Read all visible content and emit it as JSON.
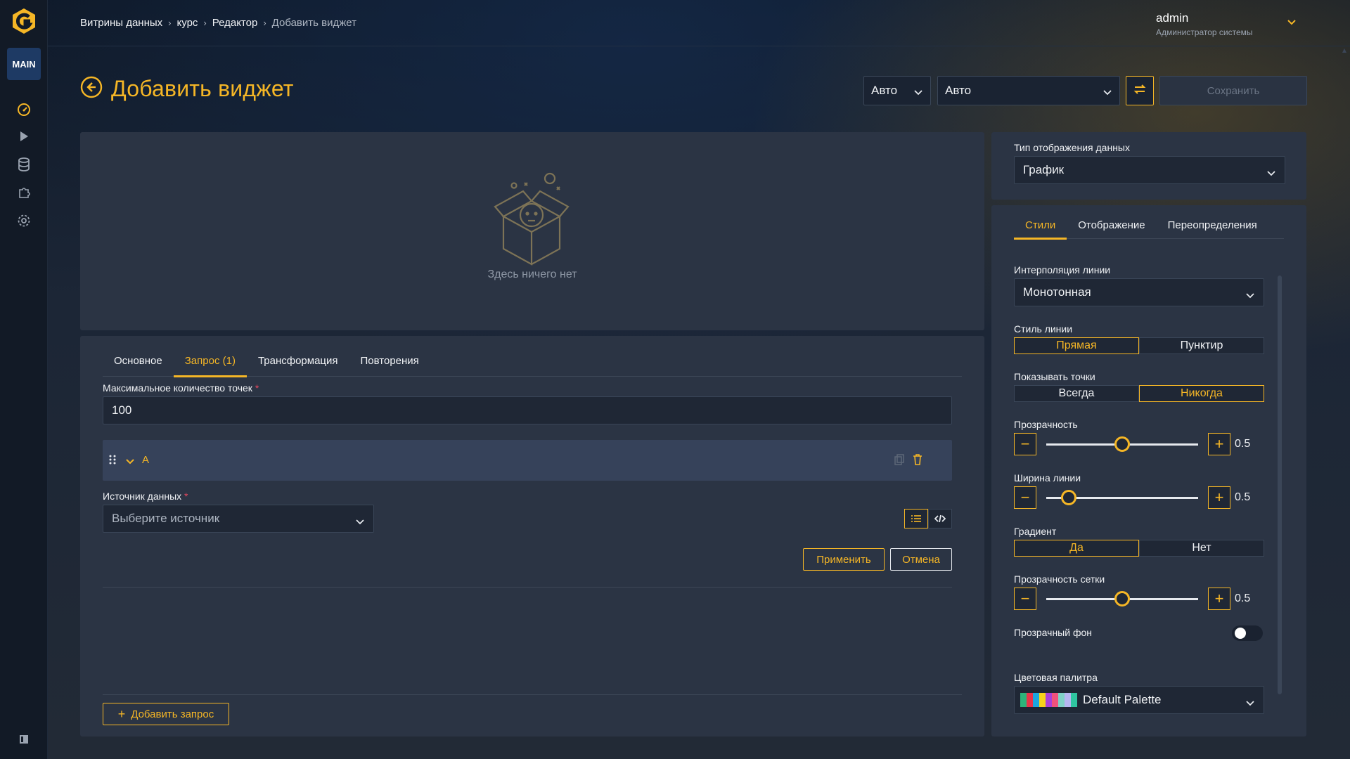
{
  "sidebar": {
    "badge": "MAIN",
    "icons": [
      "dashboard-icon",
      "play-icon",
      "database-icon",
      "puzzle-icon",
      "settings-icon",
      "panel-toggle-icon"
    ]
  },
  "breadcrumb": {
    "items": [
      "Витрины данных",
      "курс",
      "Редактор"
    ],
    "current": "Добавить виджет"
  },
  "user": {
    "name": "admin",
    "role": "Администратор системы"
  },
  "page": {
    "title": "Добавить виджет"
  },
  "toolbar": {
    "select1": "Авто",
    "select2": "Авто",
    "save_label": "Сохранить"
  },
  "preview": {
    "empty_text": "Здесь ничего нет"
  },
  "editor": {
    "tabs": [
      "Основное",
      "Запрос (1)",
      "Трансформация",
      "Повторения"
    ],
    "active_tab": "Запрос (1)",
    "max_points_label": "Максимальное количество точек",
    "max_points_value": "100",
    "query_name": "A",
    "source_label": "Источник данных",
    "source_placeholder": "Выберите источник",
    "apply_label": "Применить",
    "cancel_label": "Отмена",
    "add_query_label": "Добавить запрос"
  },
  "right": {
    "display_type_label": "Тип отображения данных",
    "display_type_value": "График",
    "tabs": [
      "Стили",
      "Отображение",
      "Переопределения"
    ],
    "active_tab": "Стили",
    "interp_label": "Интерполяция линии",
    "interp_value": "Монотонная",
    "line_style_label": "Стиль линии",
    "line_style_options": [
      "Прямая",
      "Пунктир"
    ],
    "line_style_selected": "Прямая",
    "show_points_label": "Показывать точки",
    "show_points_options": [
      "Всегда",
      "Никогда"
    ],
    "show_points_selected": "Никогда",
    "opacity_label": "Прозрачность",
    "opacity_value": "0.5",
    "opacity_level": 0.5,
    "line_width_label": "Ширина линии",
    "line_width_value": "0.5",
    "line_width_level": 0.15,
    "gradient_label": "Градиент",
    "gradient_options": [
      "Да",
      "Нет"
    ],
    "gradient_selected": "Да",
    "grid_opacity_label": "Прозрачность сетки",
    "grid_opacity_value": "0.5",
    "grid_opacity_level": 0.5,
    "transparent_bg_label": "Прозрачный фон",
    "transparent_bg_on": false,
    "palette_label": "Цветовая палитра",
    "palette_value": "Default Palette",
    "palette_colors": [
      "#2db37a",
      "#e8334a",
      "#1aa6e0",
      "#f5d21a",
      "#a93fd9",
      "#f0527c",
      "#7fd2c6",
      "#b6b6f0",
      "#2fc4a0"
    ]
  },
  "colors": {
    "accent": "#f5b626",
    "panel": "#2b3444"
  }
}
